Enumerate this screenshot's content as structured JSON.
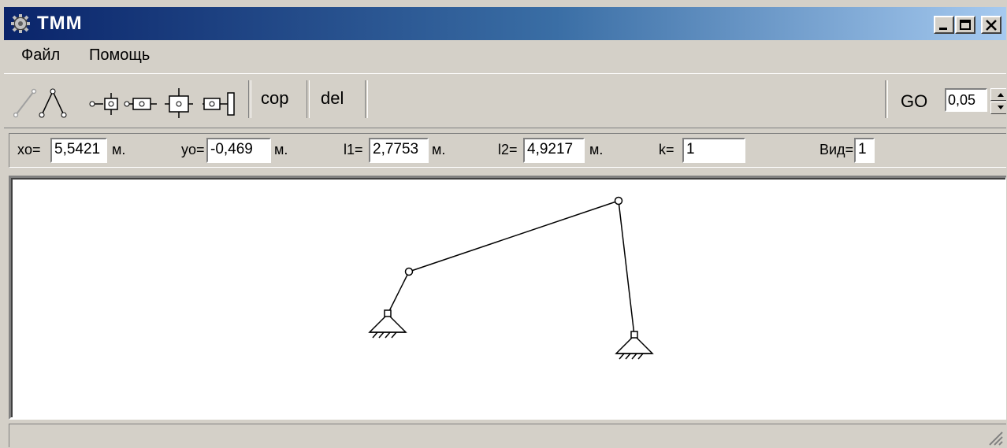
{
  "window": {
    "title": "TMM",
    "app_icon": "gear-icon"
  },
  "title_buttons": [
    {
      "name": "minimize",
      "icon": "minimize-icon"
    },
    {
      "name": "maximize",
      "icon": "maximize-icon"
    },
    {
      "name": "close",
      "icon": "close-icon"
    }
  ],
  "menu": {
    "file": "Файл",
    "help": "Помощь"
  },
  "toolbar": {
    "tools": [
      "link-tool-icon",
      "dyad-tool-icon",
      "slider-tool-icon",
      "slider-joint-tool-icon",
      "crosshead-tool-icon",
      "piston-tool-icon"
    ],
    "cop_label": "cop",
    "del_label": "del",
    "go_label": "GO",
    "go_value": "0,05"
  },
  "params": {
    "xo_label": "xo=",
    "xo_value": "5,5421",
    "xo_unit": "м.",
    "yo_label": "yo=",
    "yo_value": "-0,469",
    "yo_unit": "м.",
    "l1_label": "l1=",
    "l1_value": "2,7753",
    "l1_unit": "м.",
    "l2_label": "l2=",
    "l2_value": "4,9217",
    "l2_unit": "м.",
    "k_label": "k=",
    "k_value": "1",
    "view_label": "Вид=",
    "view_value": "1"
  },
  "status": {
    "text": ""
  },
  "colors": {
    "title_start": "#0a246a",
    "title_end": "#a6caf0",
    "face": "#d4d0c8",
    "canvas": "#ffffff"
  }
}
